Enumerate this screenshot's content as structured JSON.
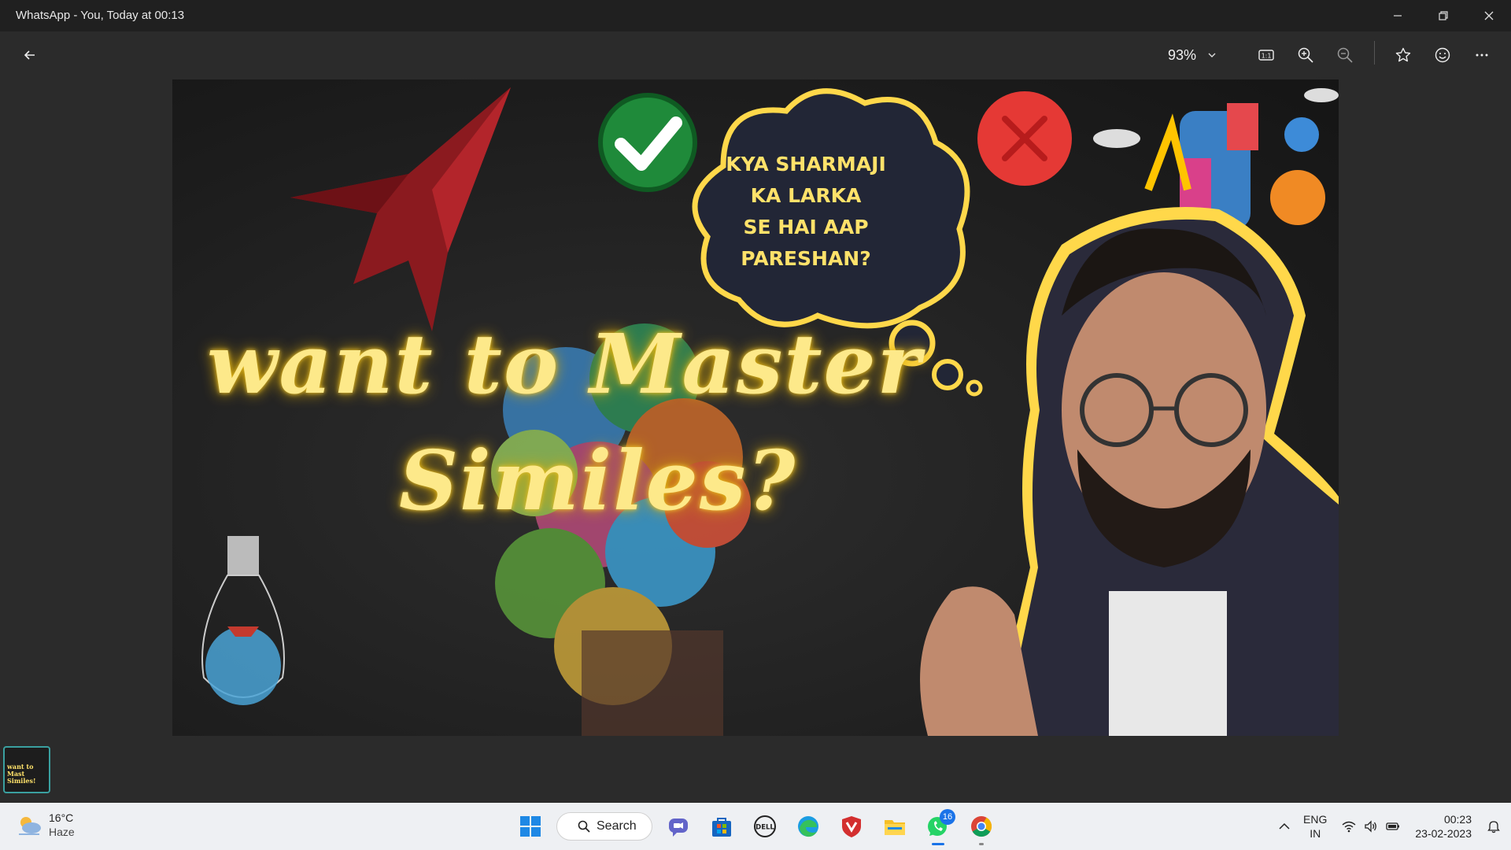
{
  "window": {
    "title": "WhatsApp - You, Today at 00:13"
  },
  "toolbar": {
    "zoom_value": "93%"
  },
  "image": {
    "headline_line1": "want to Master",
    "headline_line2": "Similes?",
    "thought_cloud": [
      "KYA SHARMAJI",
      "KA LARKA",
      "SE HAI AAP",
      "PARESHAN?"
    ]
  },
  "thumbnail": {
    "text": "want to Mast Similes!"
  },
  "taskbar": {
    "weather_temp": "16°C",
    "weather_desc": "Haze",
    "search_label": "Search",
    "whatsapp_badge": "16",
    "lang_primary": "ENG",
    "lang_secondary": "IN",
    "time": "00:23",
    "date": "23-02-2023"
  },
  "colors": {
    "headline": "#fde98a",
    "cloud_outline": "#ffd84a",
    "check_green": "#22b14c",
    "cross_red": "#e53935",
    "whatsapp_green": "#25d366"
  }
}
